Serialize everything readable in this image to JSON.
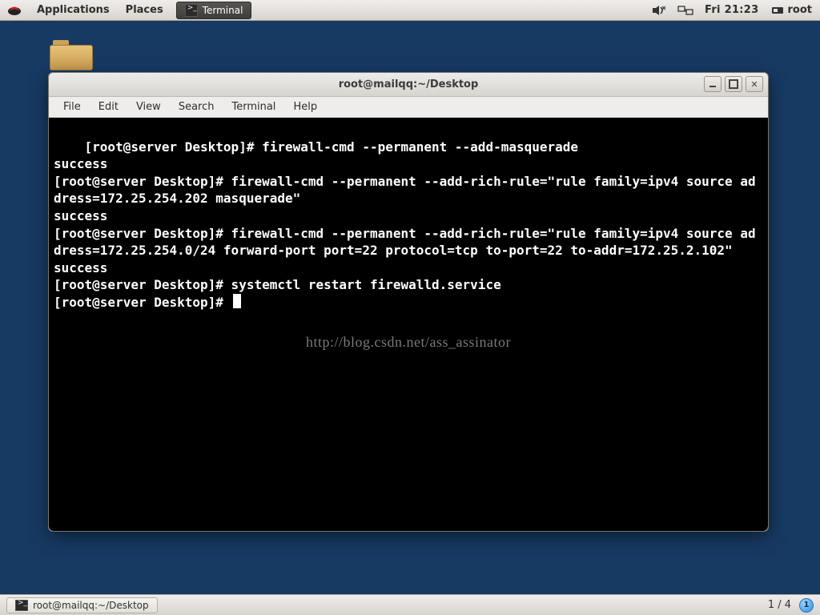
{
  "panel": {
    "applications": "Applications",
    "places": "Places",
    "task_terminal": "Terminal",
    "clock": "Fri 21:23",
    "user": "root"
  },
  "window": {
    "title": "root@mailqq:~/Desktop",
    "menus": {
      "file": "File",
      "edit": "Edit",
      "view": "View",
      "search": "Search",
      "terminal": "Terminal",
      "help": "Help"
    }
  },
  "terminal": {
    "lines": [
      "[root@server Desktop]# firewall-cmd --permanent --add-masquerade",
      "success",
      "[root@server Desktop]# firewall-cmd --permanent --add-rich-rule=\"rule family=ipv4 source address=172.25.254.202 masquerade\"",
      "success",
      "[root@server Desktop]# firewall-cmd --permanent --add-rich-rule=\"rule family=ipv4 source address=172.25.254.0/24 forward-port port=22 protocol=tcp to-port=22 to-addr=172.25.2.102\"",
      "success",
      "[root@server Desktop]# systemctl restart firewalld.service",
      "[root@server Desktop]# "
    ],
    "watermark": "http://blog.csdn.net/ass_assinator"
  },
  "bottom": {
    "task": "root@mailqq:~/Desktop",
    "workspace": "1 / 4",
    "badge": "1"
  }
}
